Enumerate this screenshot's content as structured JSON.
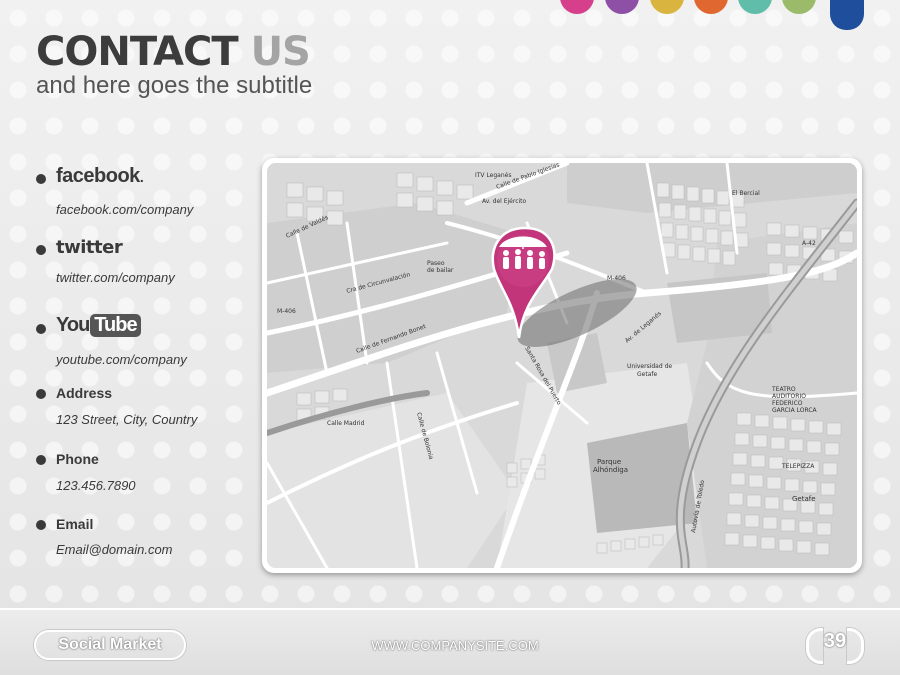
{
  "header": {
    "title_part1": "CONTACT",
    "title_part2": "US",
    "subtitle": "and here goes the subtitle"
  },
  "tabs": [
    {
      "name": "tab-pink",
      "color": "#d63f8c"
    },
    {
      "name": "tab-purple",
      "color": "#8e4fa6"
    },
    {
      "name": "tab-yellow",
      "color": "#d9b43e"
    },
    {
      "name": "tab-orange",
      "color": "#e0672f"
    },
    {
      "name": "tab-teal",
      "color": "#5fbdaa"
    },
    {
      "name": "tab-green",
      "color": "#9bbb6a"
    },
    {
      "name": "tab-blue",
      "color": "#1f4f9c"
    }
  ],
  "contacts": {
    "facebook": {
      "logo": "facebook",
      "logo_suffix": ".",
      "value": "facebook.com/company"
    },
    "twitter": {
      "logo": "twitter",
      "value": "twitter.com/company"
    },
    "youtube": {
      "logo_you": "You",
      "logo_tube": "Tube",
      "value": "youtube.com/company"
    },
    "address": {
      "label": "Address",
      "value": "123 Street, City, Country"
    },
    "phone": {
      "label": "Phone",
      "value": "123.456.7890"
    },
    "email": {
      "label": "Email",
      "value": "Email@domain.com"
    }
  },
  "map": {
    "pin_color": "#c2357a",
    "labels": {
      "itv": "ITV Leganés",
      "parque": "Parque",
      "parque2": "Alhóndiga",
      "universidad": "Universidad de",
      "universidad2": "Getafe",
      "teatro": "TEATRO",
      "auditorio": "AUDITORIO",
      "federico": "FEDERICO",
      "garcia": "GARCIA LORCA",
      "telepizza": "TELEPIZZA",
      "getafe": "Getafe",
      "bercial": "El Bercial",
      "paseo": "Paseo",
      "bailar": "de bailar",
      "a42": "A-42",
      "m406": "M-406",
      "calle1": "Calle de Pablo Iglesias",
      "calle2": "Av. de Leganés",
      "calle3": "Calle de Fernando Bonet",
      "calle4": "Av. del Ejército",
      "calle5": "Santa Rosa del Puerto",
      "calle6": "Calle Madrid",
      "calle7": "Calle de Valdés",
      "calle8": "Calle de Bolonia",
      "calle9": "Autovía de Toledo",
      "calle10": "Cra de Circunvalación"
    }
  },
  "footer": {
    "brand": "Social Market",
    "website": "WWW.COMPANYSITE.COM",
    "page_number": "39"
  }
}
